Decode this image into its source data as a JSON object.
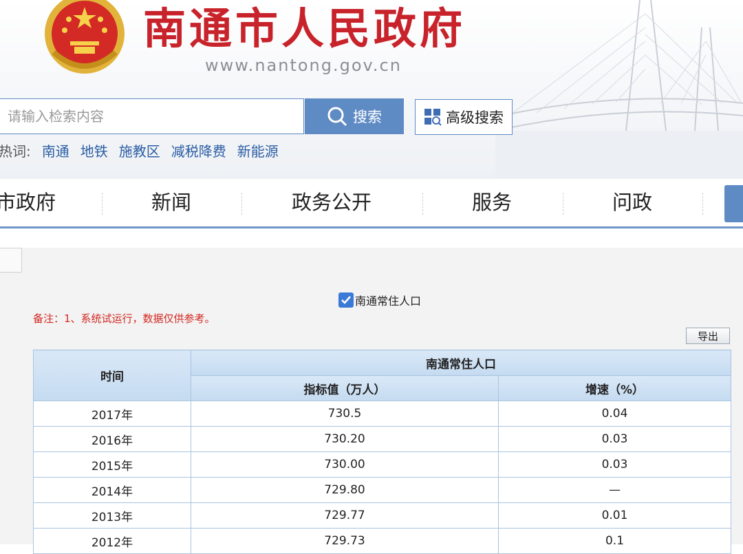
{
  "header": {
    "title": "南通市人民政府",
    "url": "www.nantong.gov.cn",
    "search": {
      "placeholder": "请输入检索内容",
      "button": "搜索"
    },
    "advanced_search": "高级搜索",
    "hot_label": "热词:",
    "hot_words": [
      "南通",
      "地铁",
      "施教区",
      "减税降费",
      "新能源"
    ]
  },
  "nav": {
    "items": [
      "市政府",
      "新闻",
      "政务公开",
      "服务",
      "问政"
    ]
  },
  "content": {
    "checkbox_label": "南通常住人口",
    "note": "备注：1、系统试运行，数据仅供参考。",
    "export": "导出",
    "table": {
      "col_time": "时间",
      "group": "南通常住人口",
      "col_value": "指标值（万人）",
      "col_growth": "增速（%）",
      "rows": [
        {
          "year": "2017年",
          "value": "730.5",
          "growth": "0.04"
        },
        {
          "year": "2016年",
          "value": "730.20",
          "growth": "0.03"
        },
        {
          "year": "2015年",
          "value": "730.00",
          "growth": "0.03"
        },
        {
          "year": "2014年",
          "value": "729.80",
          "growth": "—"
        },
        {
          "year": "2013年",
          "value": "729.77",
          "growth": "0.01"
        },
        {
          "year": "2012年",
          "value": "729.73",
          "growth": "0.1"
        }
      ]
    }
  },
  "colors": {
    "brand_red": "#c8232b",
    "accent_blue": "#5f8bc4",
    "note_red": "#d2261f"
  }
}
